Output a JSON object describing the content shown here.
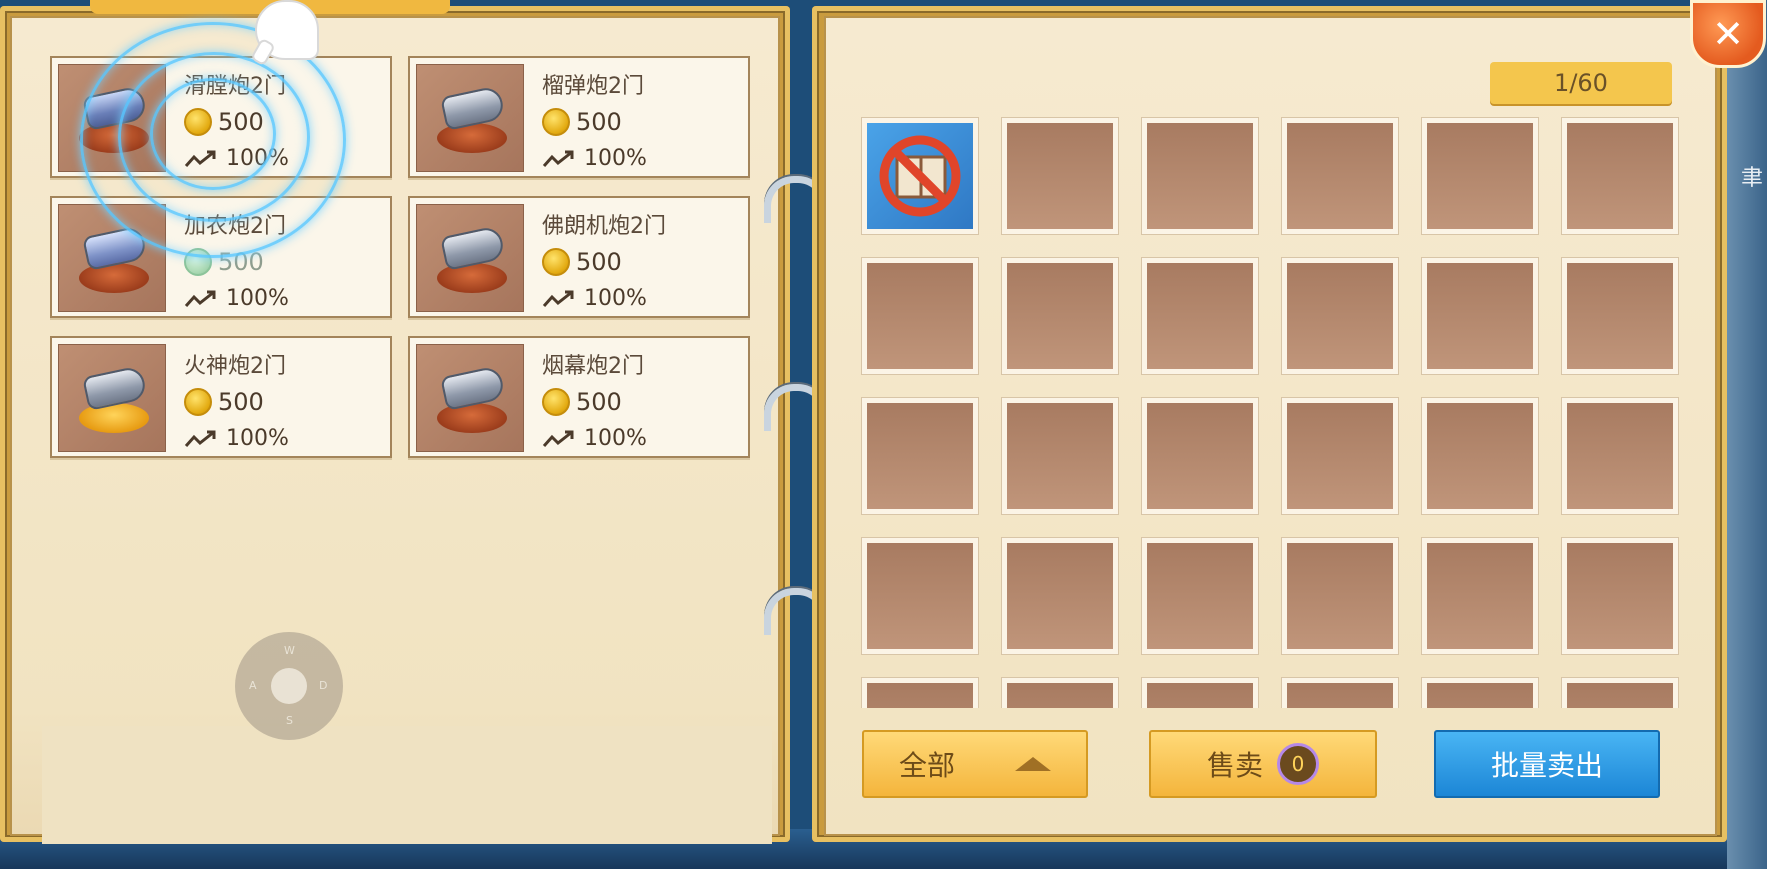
{
  "shop": {
    "items": [
      {
        "name": "滑膛炮2门",
        "price": "500",
        "rate": "100%"
      },
      {
        "name": "榴弹炮2门",
        "price": "500",
        "rate": "100%"
      },
      {
        "name": "加农炮2门",
        "price": "500",
        "rate": "100%"
      },
      {
        "name": "佛朗机炮2门",
        "price": "500",
        "rate": "100%"
      },
      {
        "name": "火神炮2门",
        "price": "500",
        "rate": "100%"
      },
      {
        "name": "烟幕炮2门",
        "price": "500",
        "rate": "100%"
      }
    ]
  },
  "joystick": {
    "up": "W",
    "left": "A",
    "right": "D",
    "down": "S"
  },
  "inventory": {
    "capacity": "1/60",
    "slot_icon": "no-book-icon"
  },
  "buttons": {
    "all_label": "全部",
    "sell_label": "售卖",
    "sell_count": "0",
    "batch_sell_label": "批量卖出"
  },
  "close_symbol": "✕",
  "edge_text": "聿",
  "colors": {
    "gold": "#f4b53c",
    "blue_button": "#1c86d6",
    "slot": "#a87b61"
  }
}
